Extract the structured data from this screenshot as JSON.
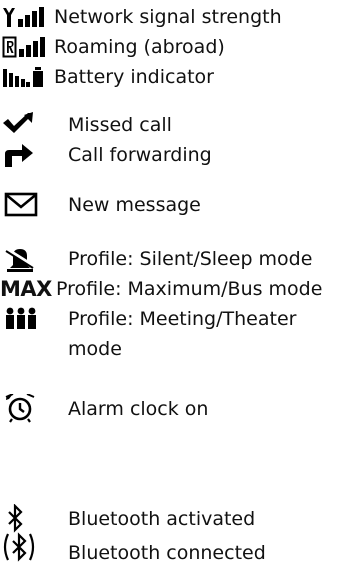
{
  "legend": [
    {
      "id": "signal",
      "icon": "antenna-signal-icon",
      "label": "Network signal strength"
    },
    {
      "id": "roaming",
      "icon": "roaming-signal-icon",
      "label": "Roaming (abroad)"
    },
    {
      "id": "battery",
      "icon": "battery-icon",
      "label": "Battery indicator"
    },
    {
      "id": "missed",
      "icon": "missed-call-icon",
      "label": "Missed call"
    },
    {
      "id": "forwarding",
      "icon": "call-forwarding-icon",
      "label": "Call forwarding"
    },
    {
      "id": "message",
      "icon": "envelope-icon",
      "label": "New message"
    },
    {
      "id": "silent",
      "icon": "silent-bell-icon",
      "label": "Profile: Silent/Sleep mode"
    },
    {
      "id": "maximum",
      "icon": "max-icon",
      "icon_text": "MAX",
      "label": "Profile: Maximum/Bus mode"
    },
    {
      "id": "meeting",
      "icon": "meeting-people-icon",
      "label": "Profile: Meeting/Theater",
      "label_continued": "mode"
    },
    {
      "id": "alarm",
      "icon": "alarm-clock-icon",
      "label": "Alarm clock on"
    },
    {
      "id": "bt_on",
      "icon": "bluetooth-icon",
      "label": "Bluetooth activated"
    },
    {
      "id": "bt_connected",
      "icon": "bluetooth-connected-icon",
      "label": "Bluetooth connected"
    }
  ],
  "colors": {
    "text": "#111111",
    "icon": "#000000",
    "background": "#ffffff"
  }
}
